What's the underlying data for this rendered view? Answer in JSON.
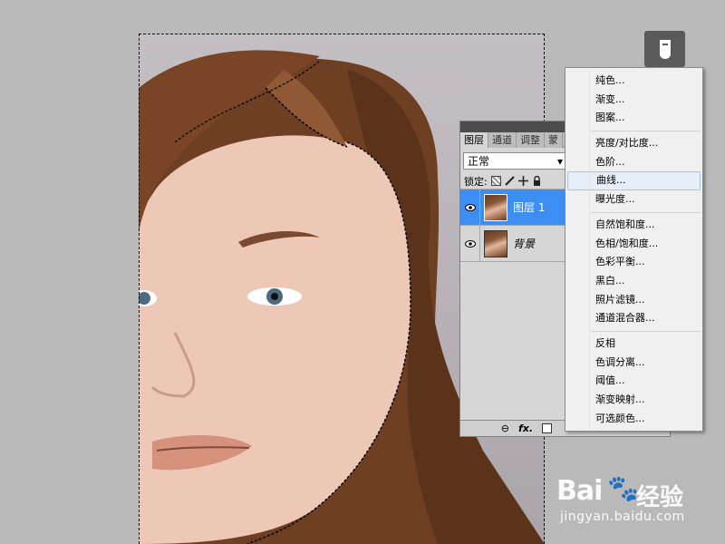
{
  "layers_panel": {
    "tabs": [
      "图层",
      "通道",
      "调整",
      "蒙"
    ],
    "blend_mode": "正常",
    "lock_label": "锁定:",
    "layers": [
      {
        "name": "图层 1",
        "selected": true
      },
      {
        "name": "背景",
        "selected": false
      }
    ],
    "footer_fx": "fx."
  },
  "adjustment_menu": {
    "groups": [
      [
        "纯色...",
        "渐变...",
        "图案..."
      ],
      [
        "亮度/对比度...",
        "色阶...",
        "曲线...",
        "曝光度..."
      ],
      [
        "自然饱和度...",
        "色相/饱和度...",
        "色彩平衡...",
        "黑白...",
        "照片滤镜...",
        "通道混合器..."
      ],
      [
        "反相",
        "色调分离...",
        "阈值...",
        "渐变映射...",
        "可选颜色..."
      ]
    ],
    "hovered_item": "曲线..."
  },
  "watermark": {
    "logo": "Bai",
    "logo_cn": "经验",
    "url": "jingyan.baidu.com"
  },
  "colors": {
    "selection_blue": "#3d8ef3",
    "menu_hover": "#e6eefa",
    "workspace_bg": "#b9b9b9"
  }
}
